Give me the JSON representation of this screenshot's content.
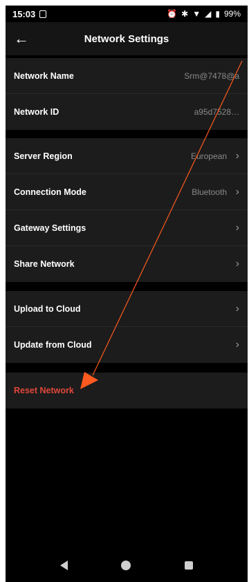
{
  "status_bar": {
    "time": "15:03",
    "icons": [
      "sim-icon",
      "alarm-icon",
      "bluetooth-icon",
      "wifi-icon",
      "signal-icon",
      "battery-icon"
    ],
    "battery": "99%"
  },
  "header": {
    "title": "Network Settings",
    "back_icon": "arrow-left-icon"
  },
  "sections": {
    "info": [
      {
        "label": "Network Name",
        "value": "Srm@7478@a"
      },
      {
        "label": "Network ID",
        "value": "a95d7528…"
      }
    ],
    "config": [
      {
        "label": "Server Region",
        "value": "European"
      },
      {
        "label": "Connection Mode",
        "value": "Bluetooth"
      },
      {
        "label": "Gateway Settings",
        "value": ""
      },
      {
        "label": "Share Network",
        "value": ""
      }
    ],
    "cloud": [
      {
        "label": "Upload to Cloud",
        "value": ""
      },
      {
        "label": "Update from Cloud",
        "value": ""
      }
    ],
    "danger": [
      {
        "label": "Reset Network",
        "value": ""
      }
    ]
  },
  "colors": {
    "background": "#000000",
    "row_background": "#1c1c1c",
    "danger": "#e0473a",
    "annotation": "#ff5a1f"
  }
}
